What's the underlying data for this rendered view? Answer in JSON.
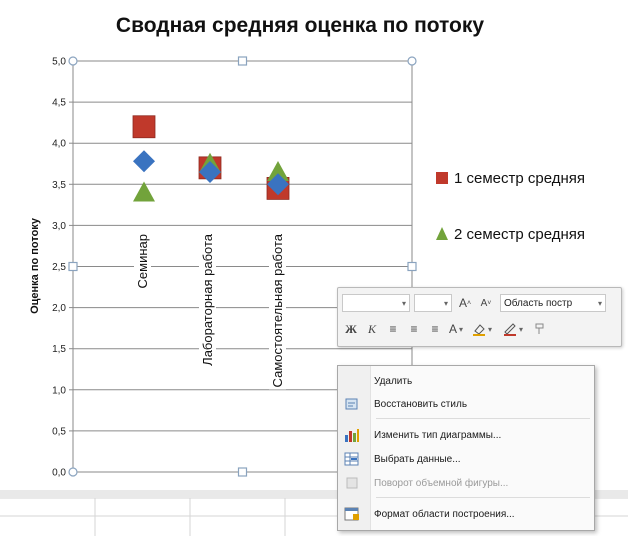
{
  "chart_data": {
    "type": "scatter",
    "title": "Сводная средняя оценка по потоку",
    "ylabel": "Оценка по потоку",
    "xlabel": "",
    "ylim": [
      0,
      5
    ],
    "yticks": [
      "0,0",
      "0,5",
      "1,0",
      "1,5",
      "2,0",
      "2,5",
      "3,0",
      "3,5",
      "4,0",
      "4,5",
      "5,0"
    ],
    "categories": [
      "Семинар",
      "Лабораторная работа",
      "Самостоятельная работа"
    ],
    "series": [
      {
        "name": "1 семестр средняя",
        "marker": "square",
        "color": "#c0392b",
        "values": [
          4.2,
          3.7,
          3.45
        ]
      },
      {
        "name": "2 семестр средняя",
        "marker": "triangle",
        "color": "#72a33b",
        "values": [
          3.4,
          3.75,
          3.65
        ]
      },
      {
        "name": "",
        "marker": "diamond",
        "color": "#3a73c0",
        "values": [
          3.78,
          3.65,
          3.5
        ]
      }
    ],
    "legend": [
      "1 семестр средняя",
      "2 семестр средняя"
    ],
    "legend_position": "right",
    "grid": true
  },
  "mini_toolbar": {
    "element_selector": "Область постр",
    "grow_font": "A",
    "shrink_font": "A",
    "bold": "Ж",
    "italic": "К",
    "font_color": "A"
  },
  "context_menu": {
    "items": [
      {
        "label": "Удалить",
        "icon": "delete-icon",
        "enabled": true
      },
      {
        "label": "Восстановить стиль",
        "icon": "reset-style-icon",
        "enabled": true
      },
      {
        "label": "Изменить тип диаграммы...",
        "icon": "chart-type-icon",
        "enabled": true
      },
      {
        "label": "Выбрать данные...",
        "icon": "select-data-icon",
        "enabled": true
      },
      {
        "label": "Поворот объемной фигуры...",
        "icon": "3d-rotation-icon",
        "enabled": false
      },
      {
        "label": "Формат области построения...",
        "icon": "format-plot-area-icon",
        "enabled": true
      }
    ]
  },
  "colors": {
    "square": "#c0392b",
    "triangle": "#72a33b",
    "diamond": "#3a73c0",
    "handle": "#8aa3bf"
  }
}
